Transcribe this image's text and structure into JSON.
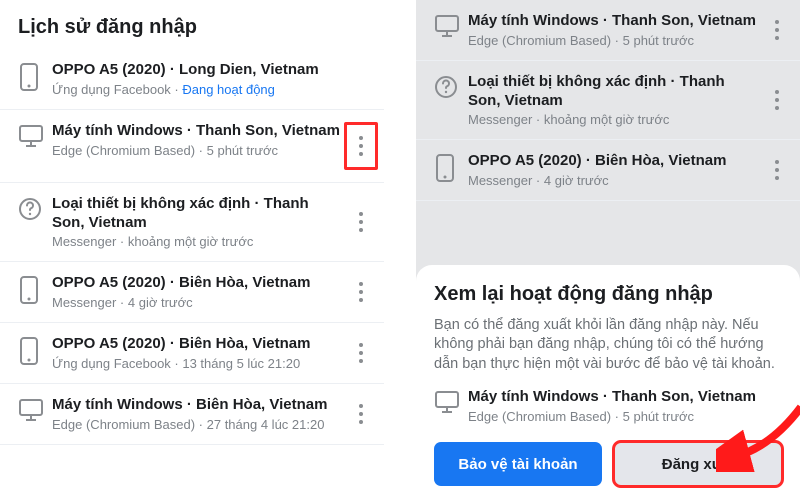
{
  "left": {
    "title": "Lịch sử đăng nhập",
    "items": [
      {
        "icon": "phone",
        "name": "OPPO A5 (2020) · Long Dien, Vietnam",
        "app": "Ứng dụng Facebook",
        "time": "Đang hoạt động",
        "active": true
      },
      {
        "icon": "desktop",
        "name": "Máy tính Windows · Thanh Son, Vietnam",
        "app": "Edge (Chromium Based)",
        "time": "5 phút trước",
        "highlightDots": true
      },
      {
        "icon": "question",
        "name": "Loại thiết bị không xác định · Thanh Son, Vietnam",
        "app": "Messenger",
        "time": "khoảng một giờ trước"
      },
      {
        "icon": "phone",
        "name": "OPPO A5 (2020) · Biên Hòa, Vietnam",
        "app": "Messenger",
        "time": "4 giờ trước"
      },
      {
        "icon": "phone",
        "name": "OPPO A5 (2020) · Biên Hòa, Vietnam",
        "app": "Ứng dụng Facebook",
        "time": "13 tháng 5 lúc 21:20"
      },
      {
        "icon": "desktop",
        "name": "Máy tính Windows · Biên Hòa, Vietnam",
        "app": "Edge (Chromium Based)",
        "time": "27 tháng 4 lúc 21:20"
      }
    ]
  },
  "right": {
    "bg_items": [
      {
        "icon": "desktop",
        "name": "Máy tính Windows · Thanh Son, Vietnam",
        "app": "Edge (Chromium Based)",
        "time": "5 phút trước"
      },
      {
        "icon": "question",
        "name": "Loại thiết bị không xác định · Thanh Son, Vietnam",
        "app": "Messenger",
        "time": "khoảng một giờ trước"
      },
      {
        "icon": "phone",
        "name": "OPPO A5 (2020) · Biên Hòa, Vietnam",
        "app": "Messenger",
        "time": "4 giờ trước"
      }
    ],
    "sheet": {
      "title": "Xem lại hoạt động đăng nhập",
      "desc": "Bạn có thể đăng xuất khỏi lần đăng nhập này. Nếu không phải bạn đăng nhập, chúng tôi có thể hướng dẫn bạn thực hiện một vài bước để bảo vệ tài khoản.",
      "item": {
        "icon": "desktop",
        "name": "Máy tính Windows · Thanh Son, Vietnam",
        "app": "Edge (Chromium Based)",
        "time": "5 phút trước"
      },
      "secure_btn": "Bảo vệ tài khoản",
      "logout_btn": "Đăng xuất"
    }
  }
}
